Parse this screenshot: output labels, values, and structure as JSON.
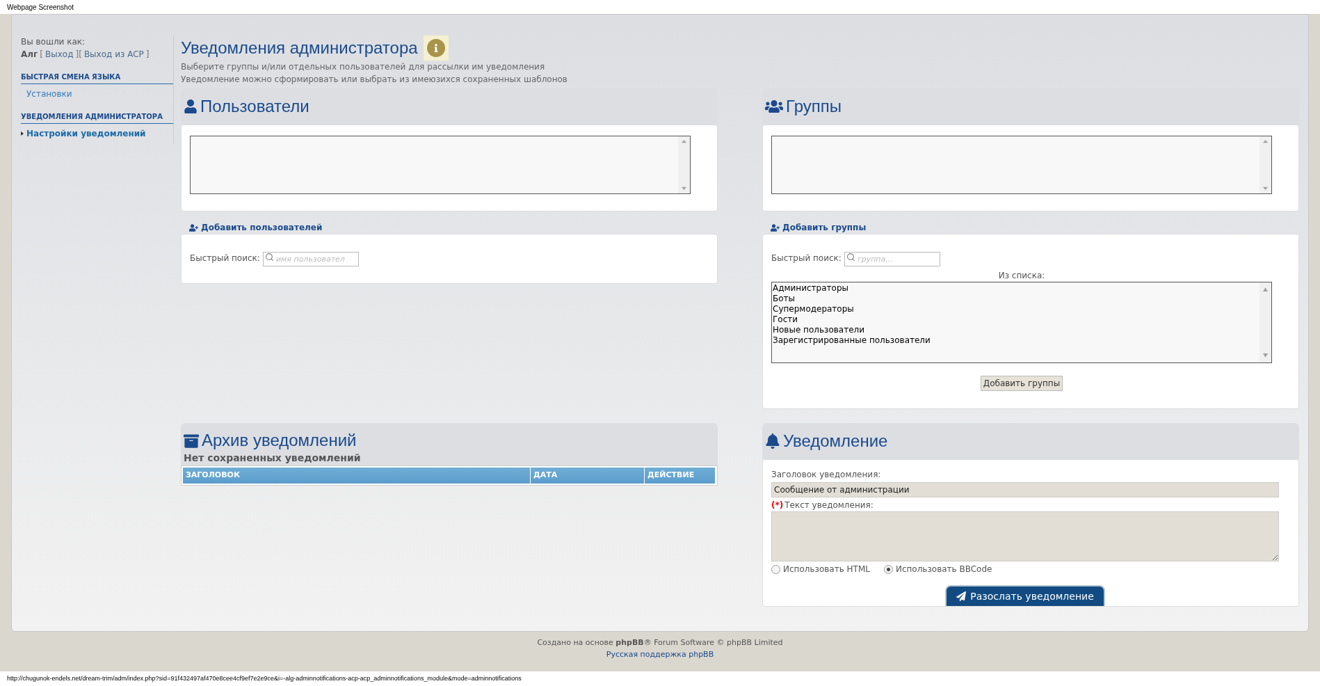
{
  "browser": {
    "title": "Webpage Screenshot",
    "status_url": "http://chugunok-endels.net/dream-trim/adm/index.php?sid=91f432497af470e8cee4cf9ef7e2e9ce&i=-alg-adminnotifications-acp-acp_adminnotifications_module&mode=adminnotifications"
  },
  "sidebar": {
    "logged_in_label": "Вы вошли как:",
    "username": "Алг",
    "login_parts": [
      {
        "kind": "plain",
        "text": "["
      },
      {
        "kind": "link",
        "text": "Выход"
      },
      {
        "kind": "plain",
        "text": "]["
      },
      {
        "kind": "link",
        "text": "Выход из ACP"
      },
      {
        "kind": "plain",
        "text": "]"
      }
    ],
    "sections": [
      {
        "heading": "БЫСТРАЯ СМЕНА ЯЗЫКА",
        "items": [
          {
            "label": "Установки",
            "selected": false
          }
        ]
      },
      {
        "heading": "УВЕДОМЛЕНИЯ АДМИНИСТРАТОРА",
        "items": [
          {
            "label": "Настройки уведомлений",
            "selected": true
          }
        ]
      }
    ]
  },
  "main": {
    "title": "Уведомления администратора",
    "description": [
      "Выберите группы и/или отдельных пользователей для рассылки им уведомления",
      "Уведомление можно сформировать или выбрать из имеюзихся сохраненных шаблонов"
    ],
    "users": {
      "title": "Пользователи",
      "add_title": "Добавить пользователей",
      "search_label": "Быстрый поиск:",
      "search_placeholder": "имя пользовател"
    },
    "groups": {
      "title": "Группы",
      "add_title": "Добавить группы",
      "search_label": "Быстрый поиск:",
      "search_placeholder": "группа...",
      "list_label": "Из списка:",
      "options": [
        "Администраторы",
        "Боты",
        "Супермодераторы",
        "Гости",
        "Новые пользователи",
        "Зарегистрированные пользователи"
      ],
      "add_button": "Добавить группы"
    },
    "archive": {
      "title": "Архив уведомлений",
      "empty_message": "Нет сохраненных уведомлений",
      "columns": [
        "ЗАГОЛОВОК",
        "ДАТА",
        "ДЕЙСТВИЕ"
      ]
    },
    "notification": {
      "title": "Уведомление",
      "subject_label": "Заголовок уведомления:",
      "subject_value": "Сообщение от администрации",
      "required_mark": "(*)",
      "text_label": "Текст уведомления:",
      "format_options": [
        {
          "label": "Использовать HTML",
          "selected": false
        },
        {
          "label": "Использовать BBCode",
          "selected": true
        }
      ],
      "send_button": "Разослать уведомление"
    }
  },
  "footer": {
    "credit": "Создано на основе **phpBB**® Forum Software © phpBB Limited",
    "support_link": "Русская поддержка phpBB"
  }
}
